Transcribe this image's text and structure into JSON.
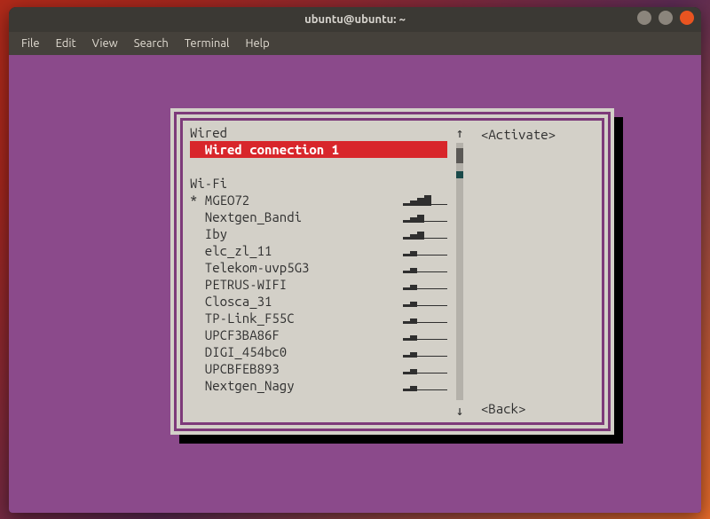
{
  "window": {
    "title": "ubuntu@ubuntu: ~"
  },
  "menubar": {
    "items": [
      "File",
      "Edit",
      "View",
      "Search",
      "Terminal",
      "Help"
    ]
  },
  "panel": {
    "sections": {
      "wired": {
        "header": "Wired",
        "items": [
          {
            "label": "Wired connection 1",
            "selected": true
          }
        ]
      },
      "wifi": {
        "header": "Wi-Fi",
        "items": [
          {
            "label": "MGEO72",
            "signal": 4,
            "active": true
          },
          {
            "label": "Nextgen_Bandi",
            "signal": 3
          },
          {
            "label": "Iby",
            "signal": 3
          },
          {
            "label": "elc_zl_11",
            "signal": 2
          },
          {
            "label": "Telekom-uvp5G3",
            "signal": 2
          },
          {
            "label": "PETRUS-WIFI",
            "signal": 2
          },
          {
            "label": "Closca_31",
            "signal": 2
          },
          {
            "label": "TP-Link_F55C",
            "signal": 2
          },
          {
            "label": "UPCF3BA86F",
            "signal": 2
          },
          {
            "label": "DIGI_454bc0",
            "signal": 2
          },
          {
            "label": "UPCBFEB893",
            "signal": 2
          },
          {
            "label": "Nextgen_Nagy",
            "signal": 2
          }
        ]
      }
    },
    "actions": {
      "activate": "<Activate>",
      "back": "<Back>"
    },
    "scroll": {
      "thumb_top_pct": 2,
      "thumb_height_pct": 6,
      "mark_top_pct": 11
    }
  }
}
